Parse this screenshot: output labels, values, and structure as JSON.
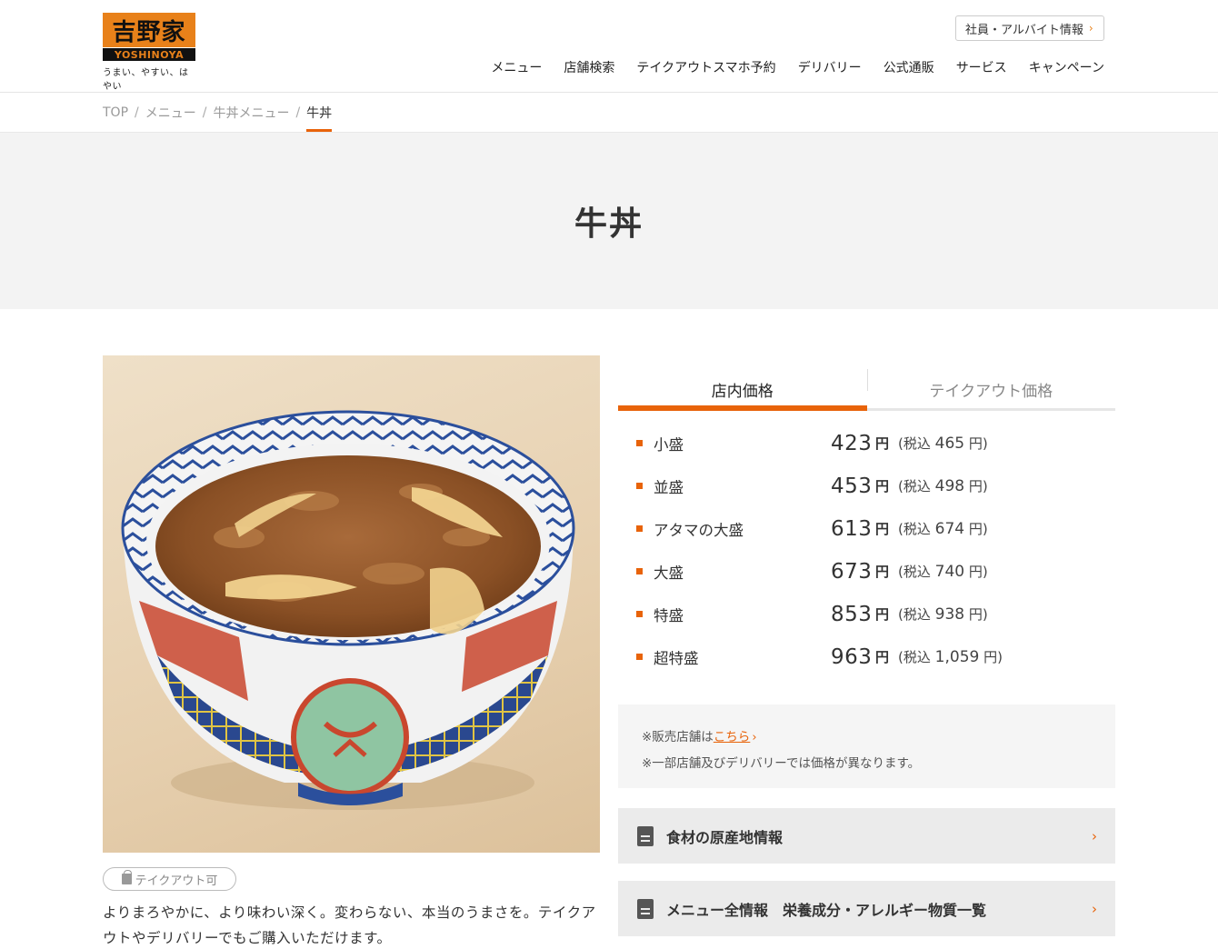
{
  "brand": {
    "logo_kanji": "吉野家",
    "logo_roman": "YOSHINOYA",
    "tagline": "うまい、やすい、はやい"
  },
  "header": {
    "recruit_label": "社員・アルバイト情報",
    "nav": [
      "メニュー",
      "店舗検索",
      "テイクアウトスマホ予約",
      "デリバリー",
      "公式通販",
      "サービス",
      "キャンペーン"
    ]
  },
  "breadcrumb": {
    "items": [
      "TOP",
      "メニュー",
      "牛丼メニュー"
    ],
    "current": "牛丼"
  },
  "page": {
    "title": "牛丼",
    "takeout_badge": "テイクアウト可",
    "description": "よりまろやかに、より味わい深く。変わらない、本当のうまさを。テイクアウトやデリバリーでもご購入いただけます。"
  },
  "price_tabs": {
    "active": "店内価格",
    "inactive": "テイクアウト価格"
  },
  "prices": [
    {
      "size": "小盛",
      "price": "423",
      "tax_price": "465"
    },
    {
      "size": "並盛",
      "price": "453",
      "tax_price": "498"
    },
    {
      "size": "アタマの大盛",
      "price": "613",
      "tax_price": "674"
    },
    {
      "size": "大盛",
      "price": "673",
      "tax_price": "740"
    },
    {
      "size": "特盛",
      "price": "853",
      "tax_price": "938"
    },
    {
      "size": "超特盛",
      "price": "963",
      "tax_price": "1,059"
    }
  ],
  "price_labels": {
    "yen": "円",
    "tax_prefix": "(税込",
    "tax_suffix": "円)"
  },
  "notes": {
    "line1_prefix": "※販売店舗は",
    "line1_link": "こちら",
    "line2": "※一部店舗及びデリバリーでは価格が異なります。"
  },
  "info_buttons": {
    "origin": "食材の原産地情報",
    "nutrition": "メニュー全情報　栄養成分・アレルギー物質一覧"
  },
  "colors": {
    "accent": "#e8630a",
    "logo_orange": "#e8811a"
  }
}
